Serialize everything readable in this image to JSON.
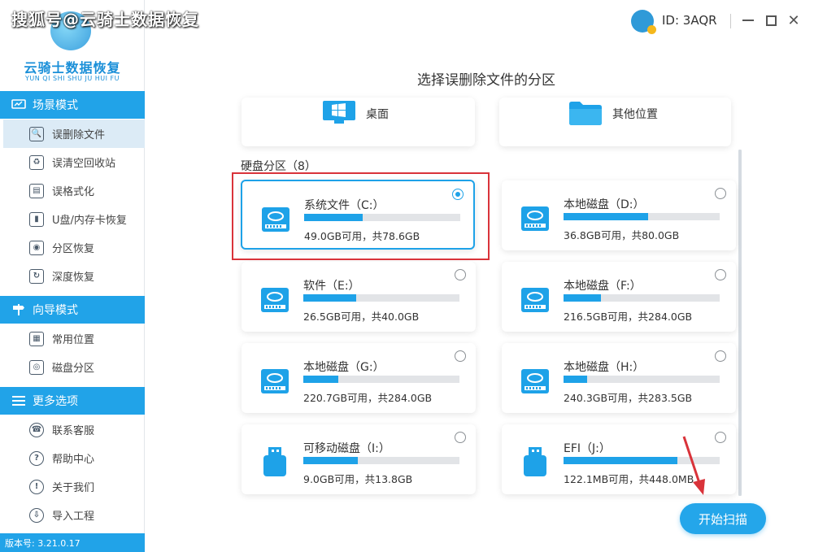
{
  "watermark": "搜狐号@云骑士数据恢复",
  "app": {
    "logo_title": "云骑士数据恢复",
    "logo_subtitle": "YUN QI SHI SHU JU HUI FU",
    "version": "版本号: 3.21.0.17",
    "accent_color": "#21a3e8"
  },
  "header": {
    "user_id": "ID: 3AQR"
  },
  "sidebar": {
    "scene_mode": {
      "title": "场景模式",
      "items": [
        {
          "label": "误删除文件",
          "icon": "file-search-icon",
          "active": true
        },
        {
          "label": "误清空回收站",
          "icon": "recycle-bin-icon",
          "active": false
        },
        {
          "label": "误格式化",
          "icon": "format-disk-icon",
          "active": false
        },
        {
          "label": "U盘/内存卡恢复",
          "icon": "usb-card-icon",
          "active": false
        },
        {
          "label": "分区恢复",
          "icon": "partition-icon",
          "active": false
        },
        {
          "label": "深度恢复",
          "icon": "deep-recover-icon",
          "active": false
        }
      ]
    },
    "guide_mode": {
      "title": "向导模式",
      "items": [
        {
          "label": "常用位置",
          "icon": "common-location-icon"
        },
        {
          "label": "磁盘分区",
          "icon": "disk-partition-icon"
        }
      ]
    },
    "more": {
      "title": "更多选项",
      "items": [
        {
          "label": "联系客服",
          "icon": "customer-service-icon"
        },
        {
          "label": "帮助中心",
          "icon": "help-icon"
        },
        {
          "label": "关于我们",
          "icon": "info-icon"
        },
        {
          "label": "导入工程",
          "icon": "import-icon"
        }
      ]
    }
  },
  "main": {
    "title": "选择误删除文件的分区",
    "locations": [
      {
        "label": "桌面",
        "icon": "desktop-windows-icon"
      },
      {
        "label": "其他位置",
        "icon": "folder-icon"
      }
    ],
    "partition_label": "硬盘分区（8）",
    "disks": [
      {
        "name": "系统文件（C:）",
        "info": "49.0GB可用，共78.6GB",
        "used_fraction": 0.377,
        "selected": true,
        "type": "hdd"
      },
      {
        "name": "本地磁盘（D:）",
        "info": "36.8GB可用，共80.0GB",
        "used_fraction": 0.54,
        "selected": false,
        "type": "hdd"
      },
      {
        "name": "软件（E:）",
        "info": "26.5GB可用，共40.0GB",
        "used_fraction": 0.338,
        "selected": false,
        "type": "hdd"
      },
      {
        "name": "本地磁盘（F:）",
        "info": "216.5GB可用，共284.0GB",
        "used_fraction": 0.238,
        "selected": false,
        "type": "hdd"
      },
      {
        "name": "本地磁盘（G:）",
        "info": "220.7GB可用，共284.0GB",
        "used_fraction": 0.223,
        "selected": false,
        "type": "hdd"
      },
      {
        "name": "本地磁盘（H:）",
        "info": "240.3GB可用，共283.5GB",
        "used_fraction": 0.152,
        "selected": false,
        "type": "hdd"
      },
      {
        "name": "可移动磁盘（I:）",
        "info": "9.0GB可用，共13.8GB",
        "used_fraction": 0.348,
        "selected": false,
        "type": "usb"
      },
      {
        "name": "EFI（J:）",
        "info": "122.1MB可用，共448.0MB",
        "used_fraction": 0.727,
        "selected": false,
        "type": "usb"
      }
    ],
    "start_button": "开始扫描"
  }
}
